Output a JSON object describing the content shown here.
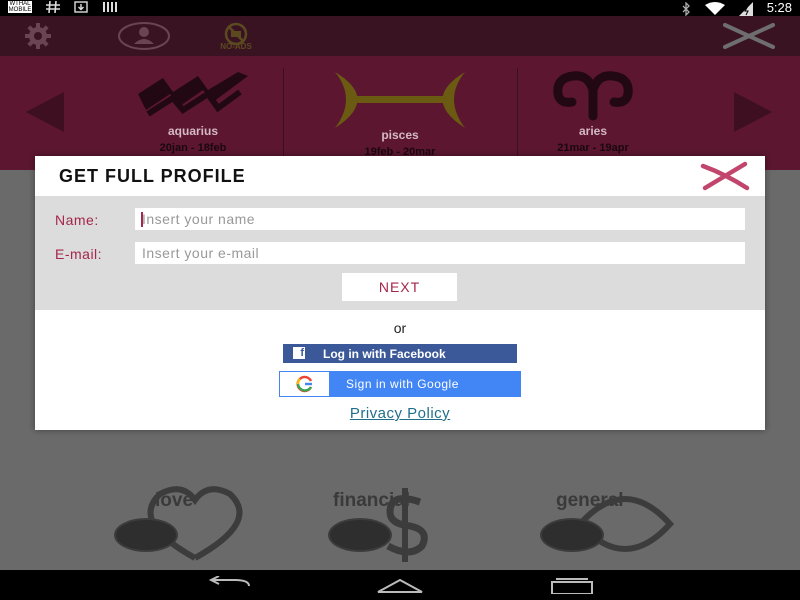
{
  "status_bar": {
    "carrier_badge": "WTHAL\nMOBILE",
    "icons": [
      "grid-icon",
      "download-icon",
      "bars-icon"
    ],
    "right_icons": [
      "bluetooth-icon",
      "wifi-icon",
      "battery-icon"
    ],
    "time": "5:28"
  },
  "toolbar": {
    "no_ads_label": "NO-ADS"
  },
  "zodiac": {
    "signs": [
      {
        "name": "aquarius",
        "dates": "20jan - 18feb"
      },
      {
        "name": "pisces",
        "dates": "19feb - 20mar"
      },
      {
        "name": "aries",
        "dates": "21mar - 19apr"
      }
    ]
  },
  "background": {
    "categories": [
      "love",
      "financial",
      "general"
    ]
  },
  "dialog": {
    "title": "GET FULL PROFILE",
    "name_label": "Name:",
    "name_placeholder": "Insert your name",
    "email_label": "E-mail:",
    "email_placeholder": "Insert your e-mail",
    "next_label": "NEXT",
    "or_text": "or",
    "facebook_label": "Log in with Facebook",
    "google_label": "Sign in with Google",
    "privacy_label": "Privacy Policy"
  },
  "colors": {
    "accent": "#a4264a",
    "facebook": "#3b5998",
    "google": "#4285f4",
    "link": "#1f6f8b"
  }
}
